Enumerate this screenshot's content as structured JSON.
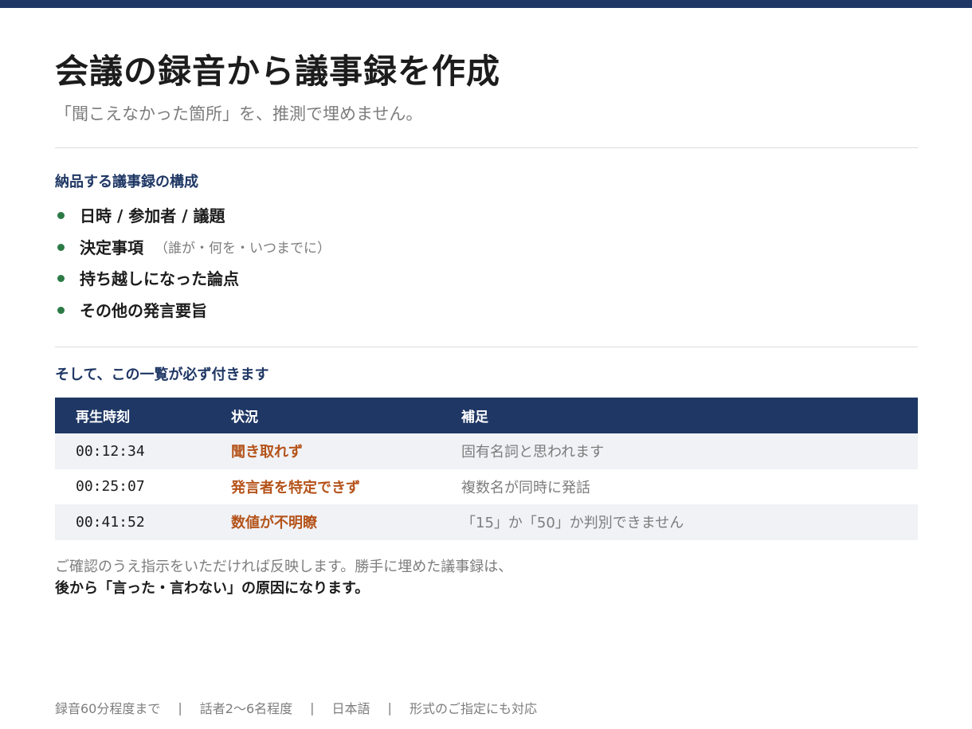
{
  "header": {
    "accent_color": "#1f3764"
  },
  "title": "会議の録音から議事録を作成",
  "subtitle": "「聞こえなかった箇所」を、推測で埋めません。",
  "structure": {
    "heading": "納品する議事録の構成",
    "items": [
      {
        "label": "日時 / 参加者 / 議題",
        "note": ""
      },
      {
        "label": "決定事項",
        "note": "（誰が・何を・いつまでに）"
      },
      {
        "label": "持ち越しになった論点",
        "note": ""
      },
      {
        "label": "その他の発言要旨",
        "note": ""
      }
    ],
    "bullet_color": "#2c7b46"
  },
  "issues": {
    "heading": "そして、この一覧が必ず付きます",
    "columns": [
      "再生時刻",
      "状況",
      "補足"
    ],
    "rows": [
      {
        "time": "00:12:34",
        "status": "聞き取れず",
        "note": "固有名詞と思われます"
      },
      {
        "time": "00:25:07",
        "status": "発言者を特定できず",
        "note": "複数名が同時に発話"
      },
      {
        "time": "00:41:52",
        "status": "数値が不明瞭",
        "note": "「15」か「50」か判別できません"
      }
    ],
    "status_color": "#b5531a"
  },
  "closing": {
    "line1": "ご確認のうえ指示をいただければ反映します。勝手に埋めた議事録は、",
    "line2": "後から「言った・言わない」の原因になります。"
  },
  "footer": {
    "items": [
      "録音60分程度まで",
      "話者2〜6名程度",
      "日本語",
      "形式のご指定にも対応"
    ],
    "separator": "|"
  }
}
